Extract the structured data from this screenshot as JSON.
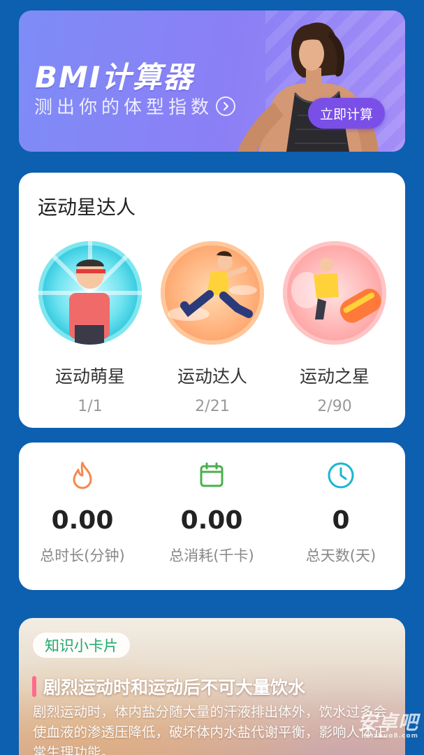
{
  "bmi_banner": {
    "title": "BMI计算器",
    "subtitle": "测出你的体型指数",
    "cta_label": "立即计算"
  },
  "achievements": {
    "title": "运动星达人",
    "badges": [
      {
        "name": "运动萌星",
        "progress": "1/1",
        "theme": "cyan"
      },
      {
        "name": "运动达人",
        "progress": "2/21",
        "theme": "orange"
      },
      {
        "name": "运动之星",
        "progress": "2/90",
        "theme": "pink"
      }
    ]
  },
  "stats": [
    {
      "icon": "flame-icon",
      "value": "0.00",
      "label": "总时长(分钟)",
      "color": "#f5874f"
    },
    {
      "icon": "calendar-icon",
      "value": "0.00",
      "label": "总消耗(千卡)",
      "color": "#4caf50"
    },
    {
      "icon": "clock-icon",
      "value": "0",
      "label": "总天数(天)",
      "color": "#19b6d2"
    }
  ],
  "knowledge_card": {
    "tag": "知识小卡片",
    "heading": "剧烈运动时和运动后不可大量饮水",
    "body": "剧烈运动时，体内盐分随大量的汗液排出体外，饮水过多会使血液的渗透压降低，破坏体内水盐代谢平衡，影响人体正常生理功能。"
  },
  "watermark": {
    "main": "安卓吧",
    "sub": "anzhuo8.com"
  },
  "colors": {
    "background": "#0d5fb0",
    "accent": "#7a4fe8",
    "tag_text": "#1fa86a"
  }
}
